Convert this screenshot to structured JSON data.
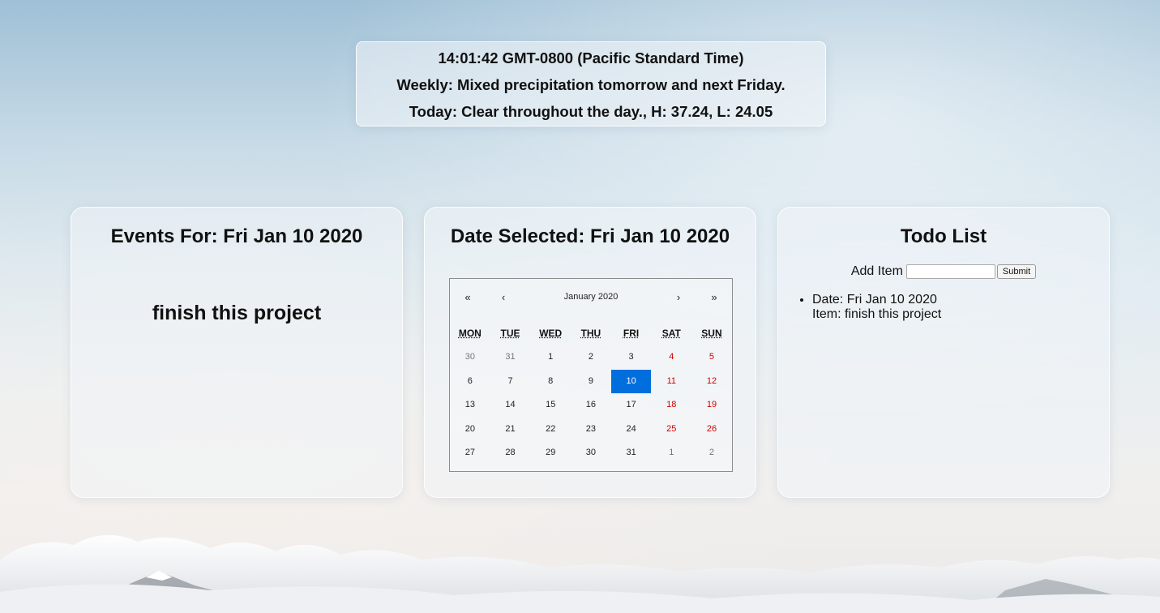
{
  "info": {
    "time": "14:01:42 GMT-0800 (Pacific Standard Time)",
    "weekly": "Weekly: Mixed precipitation tomorrow and next Friday.",
    "today": "Today: Clear throughout the day., H: 37.24, L: 24.05"
  },
  "events": {
    "title": "Events For: Fri Jan 10 2020",
    "items": [
      "finish this project"
    ]
  },
  "calendar": {
    "title": "Date Selected: Fri Jan 10 2020",
    "nav": {
      "prev_year": "«",
      "prev_month": "‹",
      "label": "January 2020",
      "next_month": "›",
      "next_year": "»"
    },
    "weekdays": [
      "MON",
      "TUE",
      "WED",
      "THU",
      "FRI",
      "SAT",
      "SUN"
    ],
    "days": [
      {
        "d": "30",
        "other": true
      },
      {
        "d": "31",
        "other": true
      },
      {
        "d": "1"
      },
      {
        "d": "2"
      },
      {
        "d": "3"
      },
      {
        "d": "4",
        "weekend": true
      },
      {
        "d": "5",
        "weekend": true
      },
      {
        "d": "6"
      },
      {
        "d": "7"
      },
      {
        "d": "8"
      },
      {
        "d": "9"
      },
      {
        "d": "10",
        "selected": true
      },
      {
        "d": "11",
        "weekend": true
      },
      {
        "d": "12",
        "weekend": true
      },
      {
        "d": "13"
      },
      {
        "d": "14"
      },
      {
        "d": "15"
      },
      {
        "d": "16"
      },
      {
        "d": "17"
      },
      {
        "d": "18",
        "weekend": true
      },
      {
        "d": "19",
        "weekend": true
      },
      {
        "d": "20"
      },
      {
        "d": "21"
      },
      {
        "d": "22"
      },
      {
        "d": "23"
      },
      {
        "d": "24"
      },
      {
        "d": "25",
        "weekend": true
      },
      {
        "d": "26",
        "weekend": true
      },
      {
        "d": "27"
      },
      {
        "d": "28"
      },
      {
        "d": "29"
      },
      {
        "d": "30"
      },
      {
        "d": "31"
      },
      {
        "d": "1",
        "other": true
      },
      {
        "d": "2",
        "other": true
      }
    ],
    "colors": {
      "selected": "#006edc",
      "weekend": "#d10000",
      "other_month": "#757575"
    }
  },
  "todo": {
    "title": "Todo List",
    "add_label": "Add Item",
    "input_value": "",
    "submit_label": "Submit",
    "items": [
      {
        "date": "Date: Fri Jan 10 2020",
        "item": "Item: finish this project"
      }
    ]
  }
}
